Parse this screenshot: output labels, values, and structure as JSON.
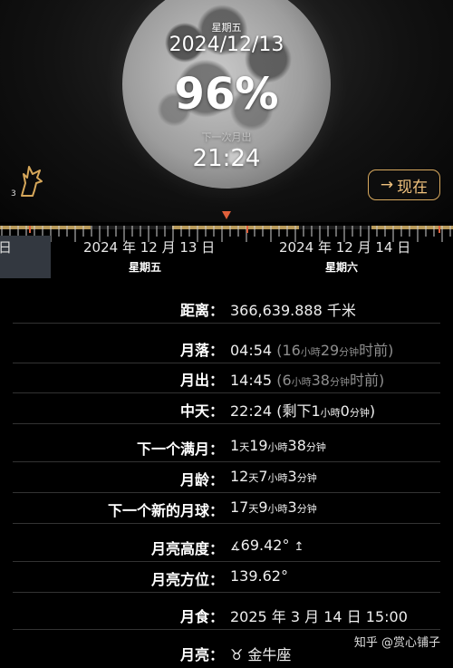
{
  "header": {
    "weekday": "星期五",
    "date": "2024/12/13",
    "illumination": "96%",
    "faded_label": "下一次月出",
    "time": "21:24",
    "badge_count": "3",
    "now_button": "现在",
    "now_icon": "arrow-right-icon"
  },
  "timeline": {
    "partial_day": "日",
    "days": [
      {
        "date": "2024 年 12 月 13 日",
        "weekday": "星期五"
      },
      {
        "date": "2024 年 12 月 14 日",
        "weekday": "星期六"
      }
    ]
  },
  "details": {
    "distance": {
      "label": "距离：",
      "value": "366,639.888 千米"
    },
    "moonset": {
      "label": "月落：",
      "time": "04:54",
      "ago_open": "(16",
      "ago_h": "小時",
      "ago_m_num": "29",
      "ago_m": "分钟",
      "ago_close": "时前)"
    },
    "moonrise": {
      "label": "月出：",
      "time": "14:45",
      "ago_open": "(6",
      "ago_h": "小時",
      "ago_m_num": "38",
      "ago_m": "分钟",
      "ago_close": "时前)"
    },
    "transit": {
      "label": "中天：",
      "time": "22:24",
      "rem_open": "(剩下",
      "rem_h_num": "1",
      "rem_h": "小時",
      "rem_m_num": "0",
      "rem_m": "分钟",
      "rem_close": ")"
    },
    "next_full": {
      "label": "下一个满月：",
      "d_num": "1",
      "d": "天",
      "h_num": "19",
      "h": "小時",
      "m_num": "38",
      "m": "分钟"
    },
    "age": {
      "label": "月龄：",
      "d_num": "12",
      "d": "天",
      "h_num": "7",
      "h": "小時",
      "m_num": "3",
      "m": "分钟"
    },
    "next_new": {
      "label": "下一个新的月球：",
      "d_num": "17",
      "d": "天",
      "h_num": "9",
      "h": "小時",
      "m_num": "3",
      "m": "分钟"
    },
    "altitude": {
      "label": "月亮高度：",
      "value": "69.42°"
    },
    "azimuth": {
      "label": "月亮方位：",
      "value": "139.62°"
    },
    "eclipse": {
      "label": "月食：",
      "value": "2025 年 3 月 14 日 15:00"
    },
    "sign": {
      "label": "月亮：",
      "value": "♉ 金牛座"
    }
  },
  "watermark": "知乎 @赏心铺子",
  "colors": {
    "accent": "#f1c27d",
    "marker": "#e0603b",
    "muted": "#8e8e8e"
  }
}
